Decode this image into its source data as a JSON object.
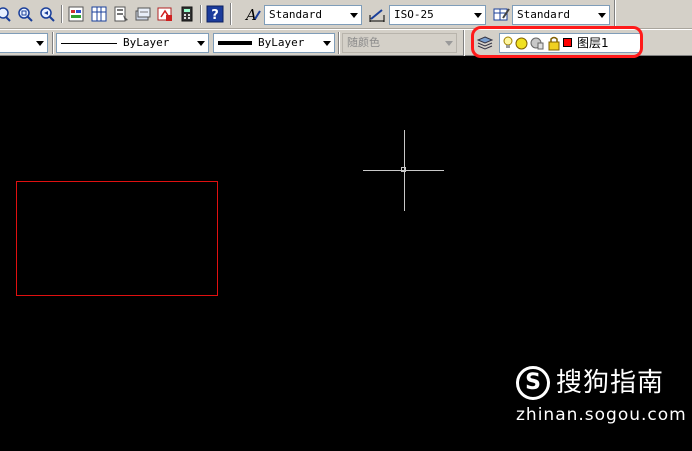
{
  "toolbar_top": {
    "text_style": "Standard",
    "dim_style": "ISO-25",
    "table_style": "Standard"
  },
  "properties_bar": {
    "color_value": "",
    "linetype_value": "ByLayer",
    "lineweight_value": "ByLayer",
    "plotstyle_value": "随颜色"
  },
  "layer_bar": {
    "current_layer": "图层1",
    "layer_color": "#ff0000"
  },
  "canvas": {
    "background": "#000000",
    "rectangle_color": "#e01010"
  },
  "watermark": {
    "logo_letter": "S",
    "title": "搜狗指南",
    "url": "zhinan.sogou.com"
  },
  "icons": [
    "zoom-realtime-icon",
    "zoom-window-icon",
    "zoom-previous-icon",
    "properties-icon",
    "design-center-icon",
    "tool-palettes-icon",
    "sheet-set-icon",
    "markup-icon",
    "quickcalc-icon",
    "help-icon",
    "text-style-icon",
    "dim-style-icon",
    "table-style-icon",
    "layer-manager-icon",
    "layer-on-icon",
    "layer-freeze-icon",
    "layer-lock-icon",
    "layer-color-swatch"
  ]
}
